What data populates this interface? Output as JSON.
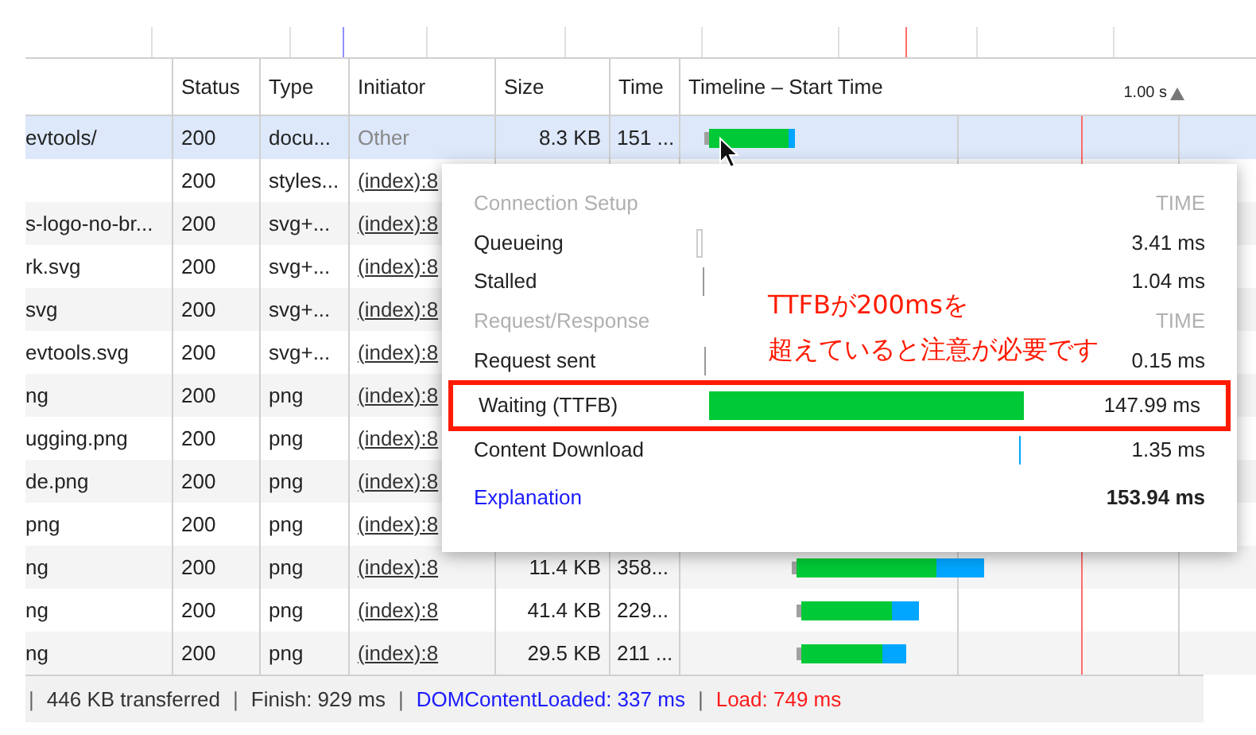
{
  "table": {
    "columns": [
      "Status",
      "Type",
      "Initiator",
      "Size",
      "Time",
      "Timeline – Start Time"
    ],
    "timeline_scale": "1.00 s",
    "rows": [
      {
        "name": "evtools/",
        "status": "200",
        "type": "docu...",
        "initiator": {
          "text": "Other",
          "kind": "plain"
        },
        "size": "8.3 KB",
        "time": "151 ...",
        "selected": true
      },
      {
        "name": "",
        "status": "200",
        "type": "styles...",
        "initiator": {
          "text": "(index):8",
          "kind": "link"
        },
        "selected": false
      },
      {
        "name": "s-logo-no-br...",
        "status": "200",
        "type": "svg+...",
        "initiator": {
          "text": "(index):8",
          "kind": "link"
        },
        "selected": false
      },
      {
        "name": "rk.svg",
        "status": "200",
        "type": "svg+...",
        "initiator": {
          "text": "(index):8",
          "kind": "link"
        },
        "selected": false
      },
      {
        "name": "svg",
        "status": "200",
        "type": "svg+...",
        "initiator": {
          "text": "(index):8",
          "kind": "link"
        },
        "selected": false
      },
      {
        "name": "evtools.svg",
        "status": "200",
        "type": "svg+...",
        "initiator": {
          "text": "(index):8",
          "kind": "link"
        },
        "selected": false
      },
      {
        "name": "ng",
        "status": "200",
        "type": "png",
        "initiator": {
          "text": "(index):8",
          "kind": "link"
        },
        "selected": false
      },
      {
        "name": "ugging.png",
        "status": "200",
        "type": "png",
        "initiator": {
          "text": "(index):8",
          "kind": "link"
        },
        "selected": false
      },
      {
        "name": "de.png",
        "status": "200",
        "type": "png",
        "initiator": {
          "text": "(index):8",
          "kind": "link"
        },
        "selected": false
      },
      {
        "name": "png",
        "status": "200",
        "type": "png",
        "initiator": {
          "text": "(index):8",
          "kind": "link"
        },
        "selected": false
      },
      {
        "name": "ng",
        "status": "200",
        "type": "png",
        "initiator": {
          "text": "(index):8",
          "kind": "link"
        },
        "size": "11.4 KB",
        "time": "358...",
        "selected": false
      },
      {
        "name": "ng",
        "status": "200",
        "type": "png",
        "initiator": {
          "text": "(index):8",
          "kind": "link"
        },
        "size": "41.4 KB",
        "time": "229...",
        "selected": false
      },
      {
        "name": "ng",
        "status": "200",
        "type": "png",
        "initiator": {
          "text": "(index):8",
          "kind": "link"
        },
        "size": "29.5 KB",
        "time": "211 ...",
        "selected": false
      }
    ]
  },
  "timing_popup": {
    "rows": [
      {
        "kind": "section",
        "label": "Connection Setup",
        "value": "TIME"
      },
      {
        "kind": "phase",
        "label": "Queueing",
        "value": "3.41 ms",
        "highlighted": false
      },
      {
        "kind": "phase",
        "label": "Stalled",
        "value": "1.04 ms",
        "highlighted": false
      },
      {
        "kind": "section",
        "label": "Request/Response",
        "value": "TIME"
      },
      {
        "kind": "phase",
        "label": "Request sent",
        "value": "0.15 ms",
        "highlighted": false
      },
      {
        "kind": "phase",
        "label": "Waiting (TTFB)",
        "value": "147.99 ms",
        "highlighted": true
      },
      {
        "kind": "phase",
        "label": "Content Download",
        "value": "1.35 ms",
        "highlighted": false
      },
      {
        "kind": "total",
        "label": "Explanation",
        "value": "153.94 ms"
      }
    ]
  },
  "annotation": [
    "TTFBが200msを",
    "超えていると注意が必要です"
  ],
  "status_bar": [
    {
      "text": "446 KB transferred",
      "color": "#333333"
    },
    {
      "text": "Finish: 929 ms",
      "color": "#333333"
    },
    {
      "text": "DOMContentLoaded: 337 ms",
      "color": "#1a1aff"
    },
    {
      "text": "Load: 749 ms",
      "color": "#ff1a1a"
    }
  ],
  "separator": "|"
}
